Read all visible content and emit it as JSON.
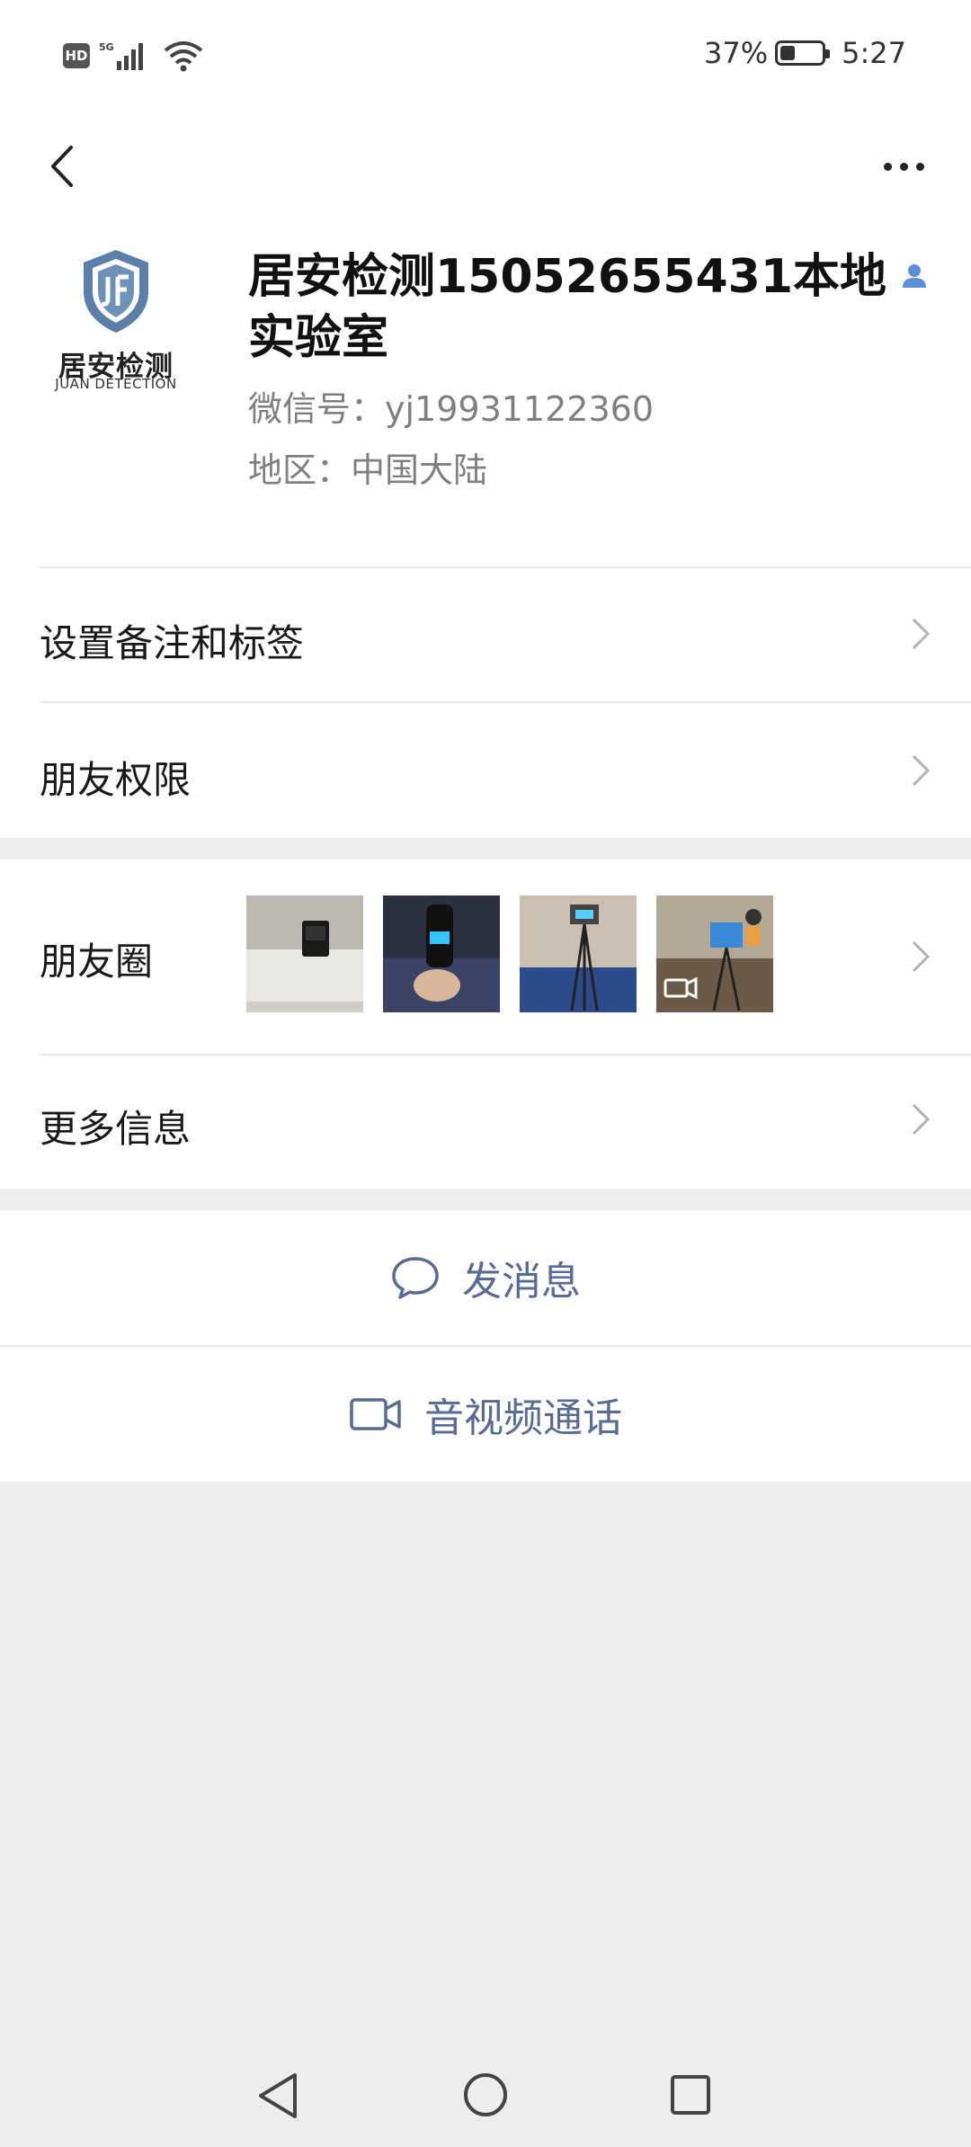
{
  "status_bar": {
    "hd": "HD",
    "network": "5G",
    "battery_percent": "37%",
    "battery_level": 0.37,
    "time": "5:27"
  },
  "profile": {
    "avatar_logo_text": "居安检测",
    "avatar_logo_subtitle": "JUAN DETECTION",
    "name": "居安检测15052655431本地实验室",
    "wechat_id": "微信号：yj19931122360",
    "region": "地区：中国大陆"
  },
  "menu": {
    "remarks_tags": "设置备注和标签",
    "friend_permissions": "朋友权限",
    "moments": "朋友圈",
    "more_info": "更多信息"
  },
  "actions": {
    "send_message": "发消息",
    "av_call": "音视频通话"
  },
  "colors": {
    "link_blue": "#576b95",
    "background": "#ededed"
  }
}
